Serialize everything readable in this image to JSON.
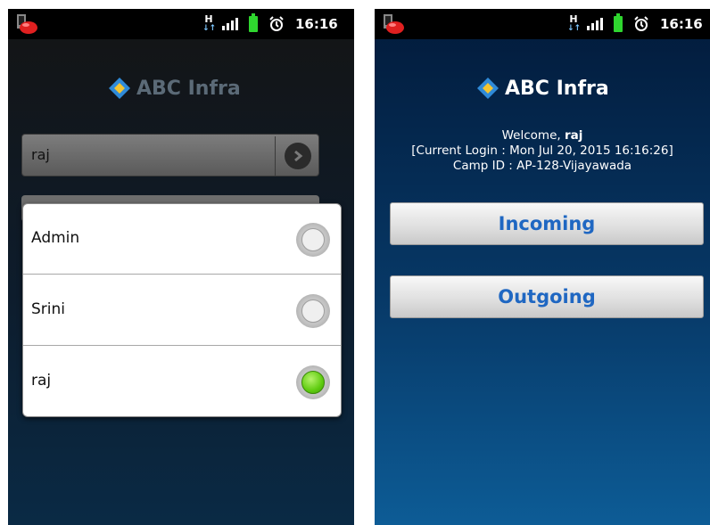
{
  "status_bar": {
    "time": "16:16",
    "network_type": "H",
    "icons": [
      "app-notification-icon",
      "network-h-icon",
      "signal-icon",
      "battery-icon",
      "alarm-icon"
    ],
    "battery_color": "#2fd62f"
  },
  "left_screen": {
    "logo_text": "ABC Infra",
    "username_value": "raj",
    "dialog_options": [
      {
        "label": "Admin",
        "selected": false
      },
      {
        "label": "Srini",
        "selected": false
      },
      {
        "label": "raj",
        "selected": true
      }
    ]
  },
  "right_screen": {
    "logo_text": "ABC Infra",
    "welcome_prefix": "Welcome,",
    "welcome_user": "raj",
    "current_login": "[Current Login : Mon Jul 20, 2015 16:16:26]",
    "camp_id": "Camp ID : AP-128-Vijayawada",
    "incoming_label": "Incoming",
    "outgoing_label": "Outgoing"
  },
  "colors": {
    "logo_blue": "#2f8ad8",
    "logo_yellow": "#f4c430",
    "button_text": "#1f67c2",
    "radio_selected": "#5fcc10"
  }
}
